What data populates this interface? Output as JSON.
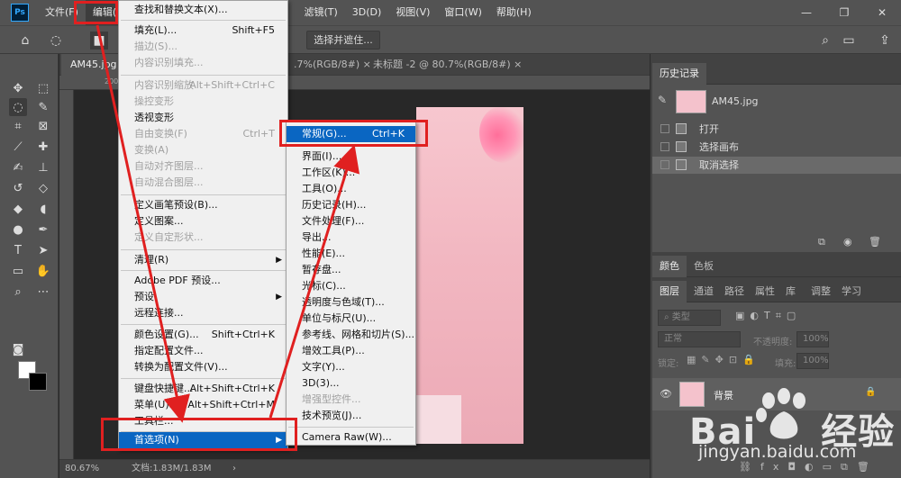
{
  "menubar": {
    "logo": "Ps",
    "items": [
      "文件(F)",
      "编辑(E)",
      "滤镜(T)",
      "3D(D)",
      "视图(V)",
      "窗口(W)",
      "帮助(H)"
    ]
  },
  "options": {
    "select_mask": "选择并遮住..."
  },
  "tabs": {
    "t1": "AM45.jpg",
    "t2": ".7%(RGB/8#)",
    "t3": "未标题 -2 @ 80.7%(RGB/8#)",
    "close": "×"
  },
  "ruler": {
    "r1": "200",
    "r2": "250"
  },
  "status": {
    "zoom": "80.67%",
    "doc": "文档:1.83M/1.83M"
  },
  "edit_menu": {
    "items": [
      {
        "label": "查找和替换文本(X)...",
        "sc": ""
      },
      {
        "label": "填充(L)...",
        "sc": "Shift+F5"
      },
      {
        "label": "描边(S)...",
        "sc": ""
      },
      {
        "label": "内容识别填充...",
        "sc": ""
      },
      {
        "label": "内容识别缩放",
        "sc": "Alt+Shift+Ctrl+C"
      },
      {
        "label": "操控变形",
        "sc": ""
      },
      {
        "label": "透视变形",
        "sc": ""
      },
      {
        "label": "自由变换(F)",
        "sc": "Ctrl+T"
      },
      {
        "label": "变换(A)",
        "sc": ""
      },
      {
        "label": "自动对齐图层...",
        "sc": ""
      },
      {
        "label": "自动混合图层...",
        "sc": ""
      },
      {
        "label": "定义画笔预设(B)...",
        "sc": ""
      },
      {
        "label": "定义图案...",
        "sc": ""
      },
      {
        "label": "定义自定形状...",
        "sc": ""
      },
      {
        "label": "清理(R)",
        "sc": ""
      },
      {
        "label": "Adobe PDF 预设...",
        "sc": ""
      },
      {
        "label": "预设",
        "sc": ""
      },
      {
        "label": "远程连接...",
        "sc": ""
      },
      {
        "label": "颜色设置(G)...",
        "sc": "Shift+Ctrl+K"
      },
      {
        "label": "指定配置文件...",
        "sc": ""
      },
      {
        "label": "转换为配置文件(V)...",
        "sc": ""
      },
      {
        "label": "键盘快捷键...",
        "sc": "Alt+Shift+Ctrl+K"
      },
      {
        "label": "菜单(U)...",
        "sc": "Alt+Shift+Ctrl+M"
      },
      {
        "label": "工具栏...",
        "sc": ""
      },
      {
        "label": "首选项(N)",
        "sc": ""
      }
    ]
  },
  "pref_menu": {
    "items": [
      {
        "label": "常规(G)...",
        "sc": "Ctrl+K"
      },
      {
        "label": "界面(I)...",
        "sc": ""
      },
      {
        "label": "工作区(K)...",
        "sc": ""
      },
      {
        "label": "工具(O)...",
        "sc": ""
      },
      {
        "label": "历史记录(H)...",
        "sc": ""
      },
      {
        "label": "文件处理(F)...",
        "sc": ""
      },
      {
        "label": "导出...",
        "sc": ""
      },
      {
        "label": "性能(E)...",
        "sc": ""
      },
      {
        "label": "暂存盘...",
        "sc": ""
      },
      {
        "label": "光标(C)...",
        "sc": ""
      },
      {
        "label": "透明度与色域(T)...",
        "sc": ""
      },
      {
        "label": "单位与标尺(U)...",
        "sc": ""
      },
      {
        "label": "参考线、网格和切片(S)...",
        "sc": ""
      },
      {
        "label": "增效工具(P)...",
        "sc": ""
      },
      {
        "label": "文字(Y)...",
        "sc": ""
      },
      {
        "label": "3D(3)...",
        "sc": ""
      },
      {
        "label": "增强型控件...",
        "sc": ""
      },
      {
        "label": "技术预览(J)...",
        "sc": ""
      },
      {
        "label": "Camera Raw(W)...",
        "sc": ""
      }
    ]
  },
  "history": {
    "tab": "历史记录",
    "snapshot": "AM45.jpg",
    "steps": [
      "打开",
      "选择画布",
      "取消选择"
    ]
  },
  "color_panel": {
    "tabs": [
      "颜色",
      "色板"
    ]
  },
  "layers_panel": {
    "tabs": [
      "图层",
      "通道",
      "路径",
      "属性",
      "库",
      "调整",
      "学习"
    ],
    "kind": "类型",
    "blend": "正常",
    "opacity_label": "不透明度:",
    "opacity": "100%",
    "lock_label": "锁定:",
    "fill_label": "填充:",
    "fill": "100%",
    "layer_name": "背景"
  },
  "watermark": {
    "brand1": "Bai",
    "brand2": "经验",
    "url": "jingyan.baidu.com"
  }
}
